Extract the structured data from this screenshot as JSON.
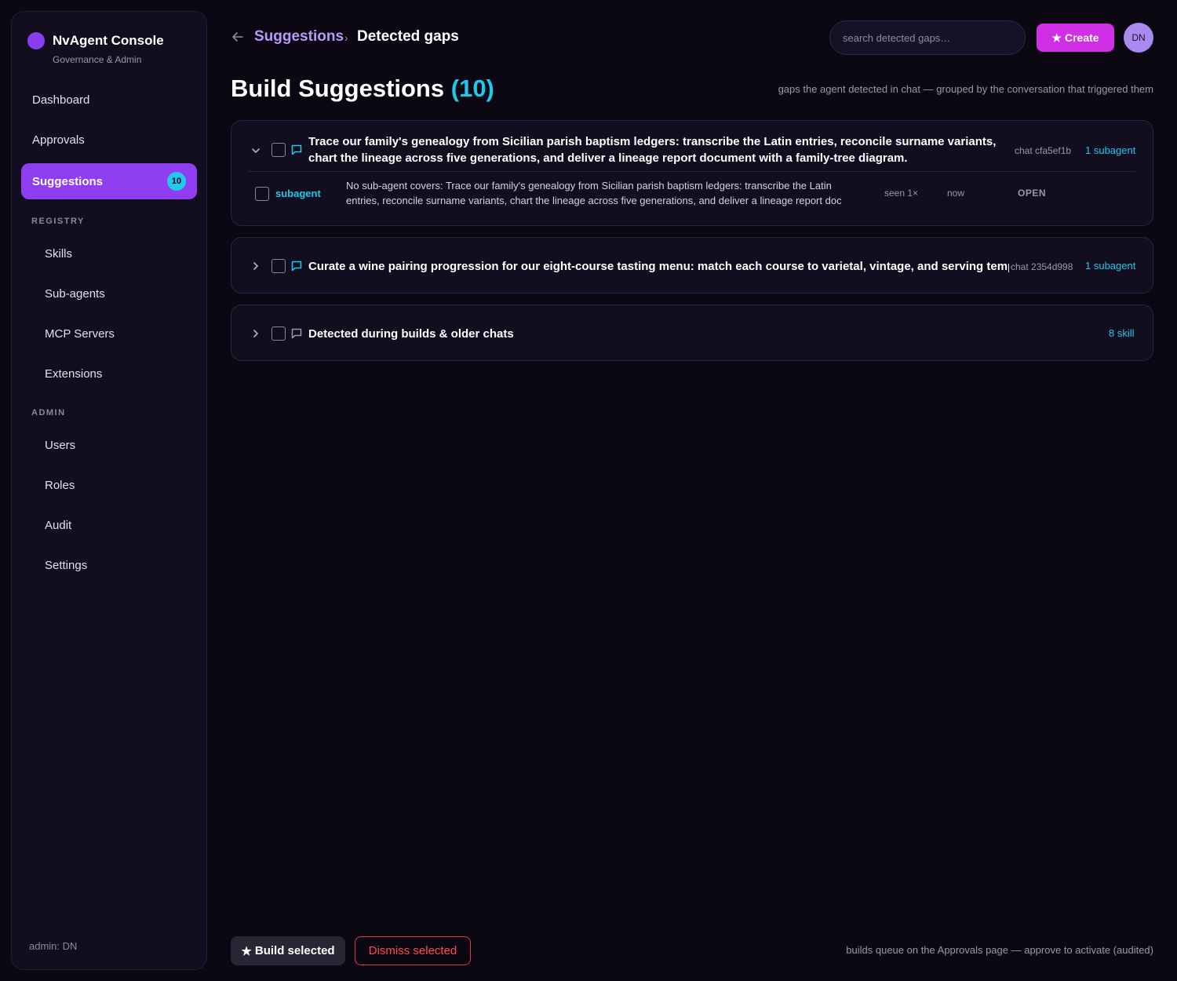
{
  "app": {
    "name": "NvAgent Console",
    "subtitle": "Governance & Admin"
  },
  "sidebar": {
    "primary": [
      {
        "label": "Dashboard"
      },
      {
        "label": "Approvals"
      },
      {
        "label": "Suggestions",
        "badge": "10",
        "active": true
      }
    ],
    "registry_label": "REGISTRY",
    "registry": [
      {
        "label": "Skills"
      },
      {
        "label": "Sub-agents"
      },
      {
        "label": "MCP Servers"
      },
      {
        "label": "Extensions"
      }
    ],
    "admin_label": "ADMIN",
    "admin": [
      {
        "label": "Users"
      },
      {
        "label": "Roles"
      },
      {
        "label": "Audit"
      },
      {
        "label": "Settings"
      }
    ],
    "footer": "admin: DN"
  },
  "header": {
    "breadcrumb_parent": "Suggestions",
    "breadcrumb_sep": "›",
    "breadcrumb_current": "Detected gaps",
    "search_placeholder": "search detected gaps…",
    "create_label": "Create",
    "avatar_initials": "DN"
  },
  "page": {
    "title": "Build Suggestions",
    "count": "(10)",
    "subtitle": "gaps the agent detected in chat — grouped by the conversation that triggered them"
  },
  "groups": [
    {
      "title": "Trace our family's genealogy from Sicilian parish baptism ledgers: transcribe the Latin entries, reconcile surname variants, chart the lineage across five generations, and deliver a lineage report document with a family-tree diagram.",
      "chat_id": "chat cfa5ef1b",
      "count_label": "1 subagent",
      "expanded": true,
      "rows": [
        {
          "kind": "subagent",
          "description": "No sub-agent covers: Trace our family's genealogy from Sicilian parish baptism ledgers: transcribe the Latin entries, reconcile surname variants, chart the lineage across five generations, and deliver a lineage report doc",
          "seen": "seen 1×",
          "when": "now",
          "status": "OPEN"
        }
      ]
    },
    {
      "title": "Curate a wine pairing progression for our eight-course tasting menu: match each course to varietal, vintage, and serving temperature,…",
      "chat_id": "chat 2354d998",
      "count_label": "1 subagent",
      "expanded": false
    },
    {
      "title": "Detected during builds & older chats",
      "count_label": "8 skill",
      "expanded": false
    }
  ],
  "footer": {
    "build_label": "Build selected",
    "dismiss_label": "Dismiss selected",
    "note": "builds queue on the Approvals page — approve to activate (audited)"
  },
  "colors": {
    "accent_purple": "#8e3df0",
    "accent_magenta": "#d12fe6",
    "accent_cyan": "#22c8ec",
    "danger": "#e23b3b",
    "background": "#0b0813"
  }
}
